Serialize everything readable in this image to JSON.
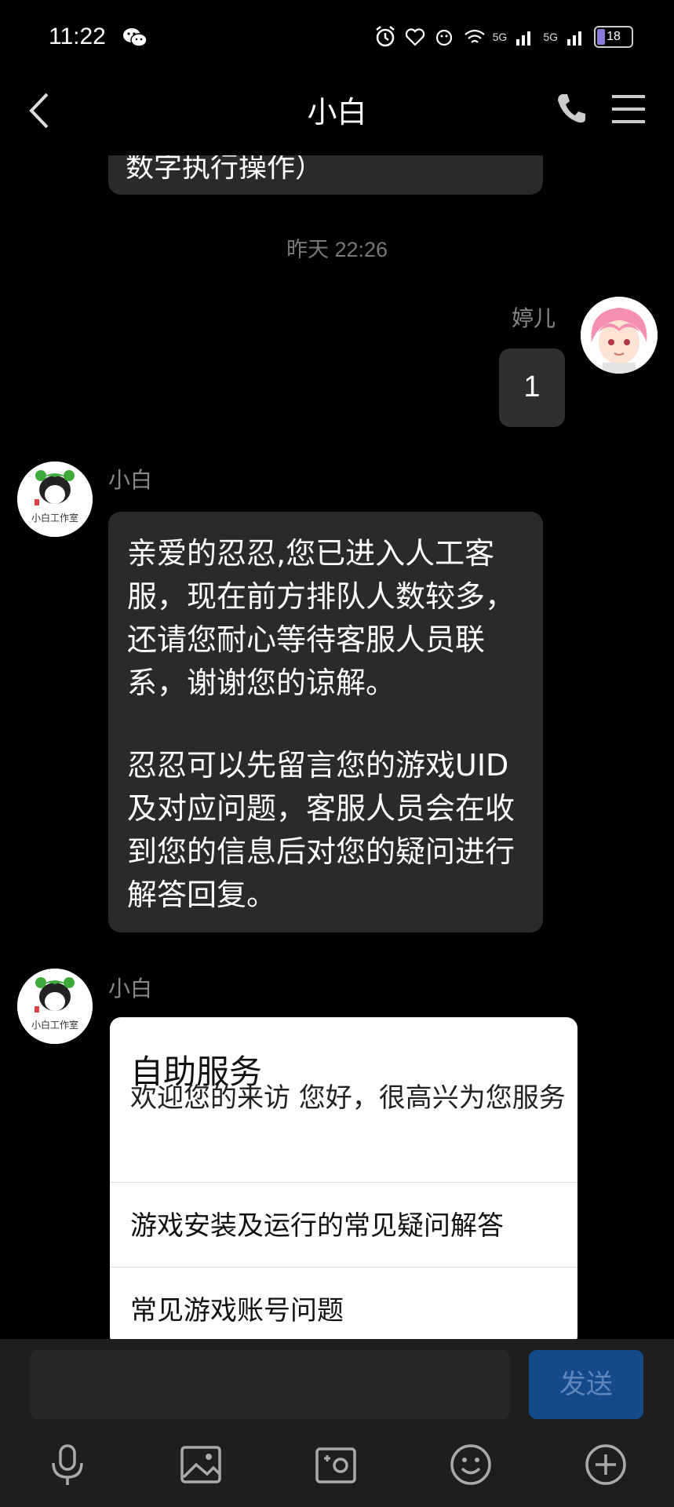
{
  "status_bar": {
    "time": "11:22",
    "network_1": "5G",
    "network_2": "5G",
    "battery": "18"
  },
  "header": {
    "title": "小白"
  },
  "messages": {
    "cut_off_text": "数字执行操作）",
    "timestamp": "昨天 22:26",
    "user_name": "婷儿",
    "user_message": "1",
    "bot_name_1": "小白",
    "bot_message_p1": "亲爱的忍忍,您已进入人工客服，现在前方排队人数较多，还请您耐心等待客服人员联系，谢谢您的谅解。",
    "bot_message_p2": "忍忍可以先留言您的游戏UID及对应问题，客服人员会在收到您的信息后对您的疑问进行解答回复。",
    "bot_name_2": "小白"
  },
  "service_card": {
    "title": "自助服务",
    "subtitle": "欢迎您的来访 您好，很高兴为您服务",
    "options": [
      "游戏安装及运行的常见疑问解答",
      "常见游戏账号问题"
    ]
  },
  "input": {
    "placeholder": "",
    "send_label": "发送"
  },
  "toolbar": [
    "microphone-icon",
    "image-icon",
    "camera-icon",
    "emoji-icon",
    "plus-icon"
  ],
  "colors": {
    "background": "#000000",
    "bubble": "#2a2a2a",
    "send_button": "#154a8a",
    "card": "#ffffff"
  }
}
